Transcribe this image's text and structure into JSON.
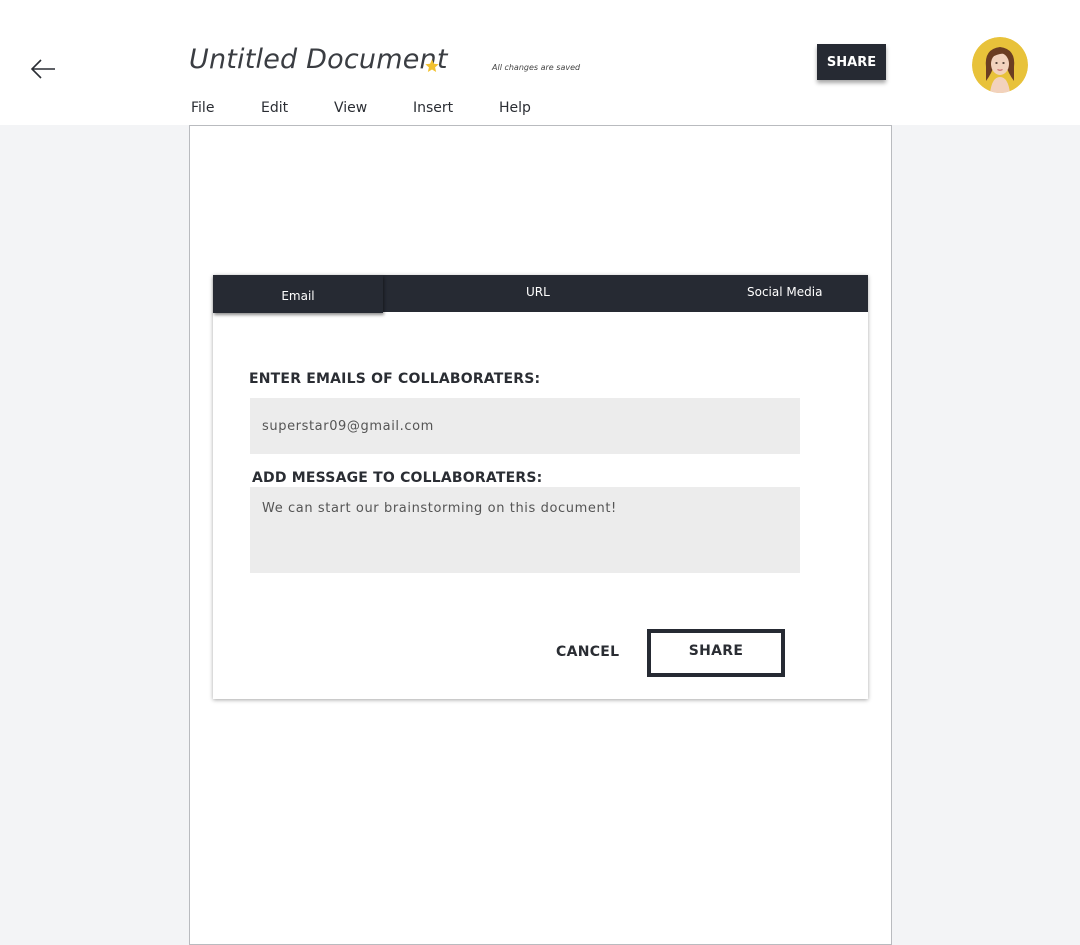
{
  "header": {
    "title": "Untitled Document",
    "save_status": "All changes are saved",
    "share_label": "SHARE",
    "star_color": "#f2c12e"
  },
  "menu": {
    "items": [
      "File",
      "Edit",
      "View",
      "Insert",
      "Help"
    ]
  },
  "share_dialog": {
    "tabs": [
      "Email",
      "URL",
      "Social Media"
    ],
    "active_tab": "Email",
    "email_label": "ENTER EMAILS OF COLLABORATERS:",
    "email_value": "superstar09@gmail.com",
    "message_label": "ADD MESSAGE TO COLLABORATERS:",
    "message_value": "We can start our brainstorming on this document!",
    "cancel_label": "CANCEL",
    "share_label": "SHARE"
  },
  "colors": {
    "dark": "#262a33",
    "field_bg": "#ececec",
    "page_bg": "#f3f4f6"
  }
}
